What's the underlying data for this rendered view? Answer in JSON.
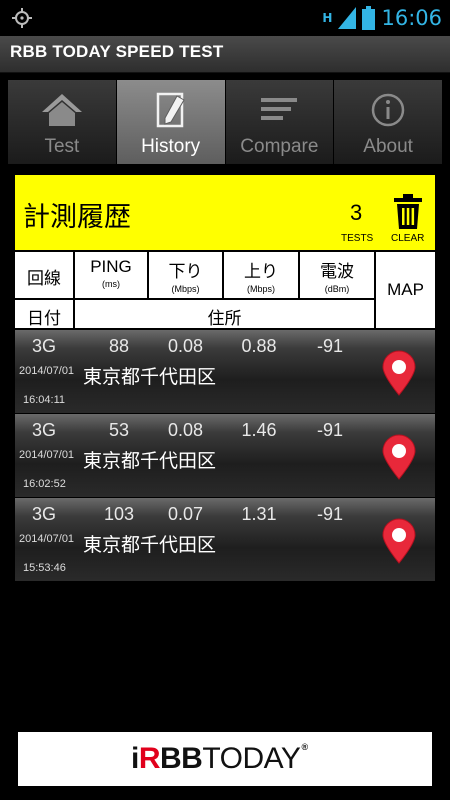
{
  "status_bar": {
    "network": "H",
    "time": "16:06"
  },
  "app_bar": {
    "title": "RBB TODAY SPEED TEST"
  },
  "tabs": [
    {
      "label": "Test",
      "icon": "home-icon",
      "active": false
    },
    {
      "label": "History",
      "icon": "edit-icon",
      "active": true
    },
    {
      "label": "Compare",
      "icon": "list-lines-icon",
      "active": false
    },
    {
      "label": "About",
      "icon": "info-icon",
      "active": false
    }
  ],
  "header": {
    "title": "計測履歴",
    "count": "3",
    "count_label": "TESTS",
    "clear_label": "CLEAR",
    "background": "#ffff00"
  },
  "columns": {
    "line": "回線",
    "ping": "PING",
    "ping_unit": "(ms)",
    "down": "下り",
    "down_unit": "(Mbps)",
    "up": "上り",
    "up_unit": "(Mbps)",
    "signal": "電波",
    "signal_unit": "(dBm)",
    "map": "MAP",
    "date": "日付",
    "address": "住所"
  },
  "rows": [
    {
      "line": "3G",
      "ping": "88",
      "down": "0.08",
      "up": "0.88",
      "signal": "-91",
      "date": "2014/07/01",
      "time": "16:04:11",
      "address": "東京都千代田区"
    },
    {
      "line": "3G",
      "ping": "53",
      "down": "0.08",
      "up": "1.46",
      "signal": "-91",
      "date": "2014/07/01",
      "time": "16:02:52",
      "address": "東京都千代田区"
    },
    {
      "line": "3G",
      "ping": "103",
      "down": "0.07",
      "up": "1.31",
      "signal": "-91",
      "date": "2014/07/01",
      "time": "15:53:46",
      "address": "東京都千代田区"
    }
  ],
  "banner": {
    "logo_prefix": "i",
    "logo_r": "R",
    "logo_bb": "BB",
    "logo_suffix": "TODAY",
    "logo_reg": "®",
    "accent": "#e1001c"
  }
}
